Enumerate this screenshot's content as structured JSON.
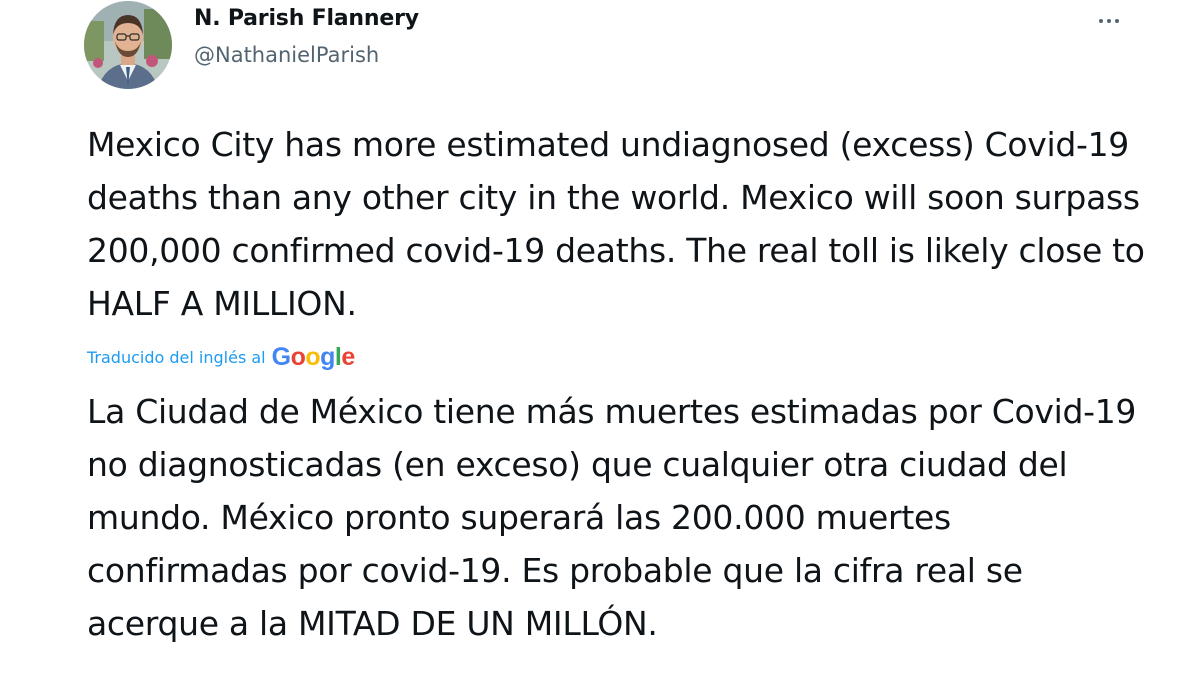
{
  "author": {
    "display_name": "N. Parish Flannery",
    "handle": "@NathanielParish"
  },
  "tweet": {
    "original_text": "Mexico City has more estimated undiagnosed (excess) Covid-19 deaths than any other city in the world. Mexico will soon surpass 200,000 confirmed covid-19 deaths. The real toll is likely close to HALF A MILLION.",
    "translation_label": "Traducido del inglés al",
    "translation_provider": "Google",
    "translated_text": "La Ciudad de México tiene más muertes estimadas por Covid-19 no diagnosticadas (en exceso) que cualquier otra ciudad del mundo. México pronto superará las 200.000 muertes confirmadas por covid-19. Es probable que la cifra real se acerque a la MITAD DE UN MILLÓN."
  },
  "icons": {
    "more": "more-horizontal-icon",
    "avatar": "profile-photo"
  },
  "colors": {
    "text_primary": "#0f1419",
    "text_secondary": "#536471",
    "link_blue": "#1d9bf0",
    "google_blue": "#4285f4",
    "google_red": "#ea4335",
    "google_yellow": "#fbbc05",
    "google_green": "#34a853"
  }
}
